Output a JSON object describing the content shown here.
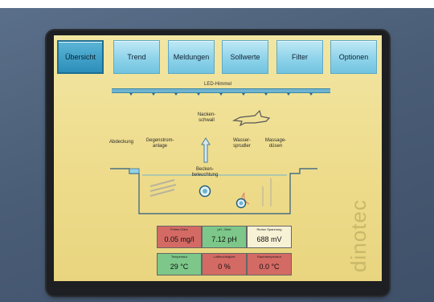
{
  "menu": [
    {
      "label": "Übersicht",
      "active": true
    },
    {
      "label": "Trend",
      "active": false
    },
    {
      "label": "Meldungen",
      "active": false
    },
    {
      "label": "Sollwerte",
      "active": false
    },
    {
      "label": "Filter",
      "active": false
    },
    {
      "label": "Optionen",
      "active": false
    }
  ],
  "diagram": {
    "led_label": "LED-Himmel",
    "neck": "Nacken-\nschwall",
    "cover": "Abdeckung",
    "counter": "Gegenstrom-\nanlage",
    "water": "Wasser-\nsprudler",
    "massage": "Massage-\ndüsen",
    "light": "Becken-\nbeleuchtung"
  },
  "readings": [
    {
      "caption": "Freies Chlor",
      "value": "0.05 mg/l",
      "color": "red"
    },
    {
      "caption": "pH - Wert",
      "value": "7.12 pH",
      "color": "green"
    },
    {
      "caption": "Redox Spannung",
      "value": "688 mV",
      "color": "cream"
    },
    {
      "caption": "Temperatur",
      "value": "29 °C",
      "color": "green"
    },
    {
      "caption": "Luftfeuchtigkeit",
      "value": "0 %",
      "color": "red"
    },
    {
      "caption": "Raumtemperatur",
      "value": "0.0 °C",
      "color": "red"
    }
  ],
  "brand": "dinotec",
  "colors": {
    "screen": "#eedc8c",
    "button": "#8ed3ea",
    "alarm": "#d46a64",
    "ok": "#7cc789",
    "neutral": "#f7f2d6"
  }
}
